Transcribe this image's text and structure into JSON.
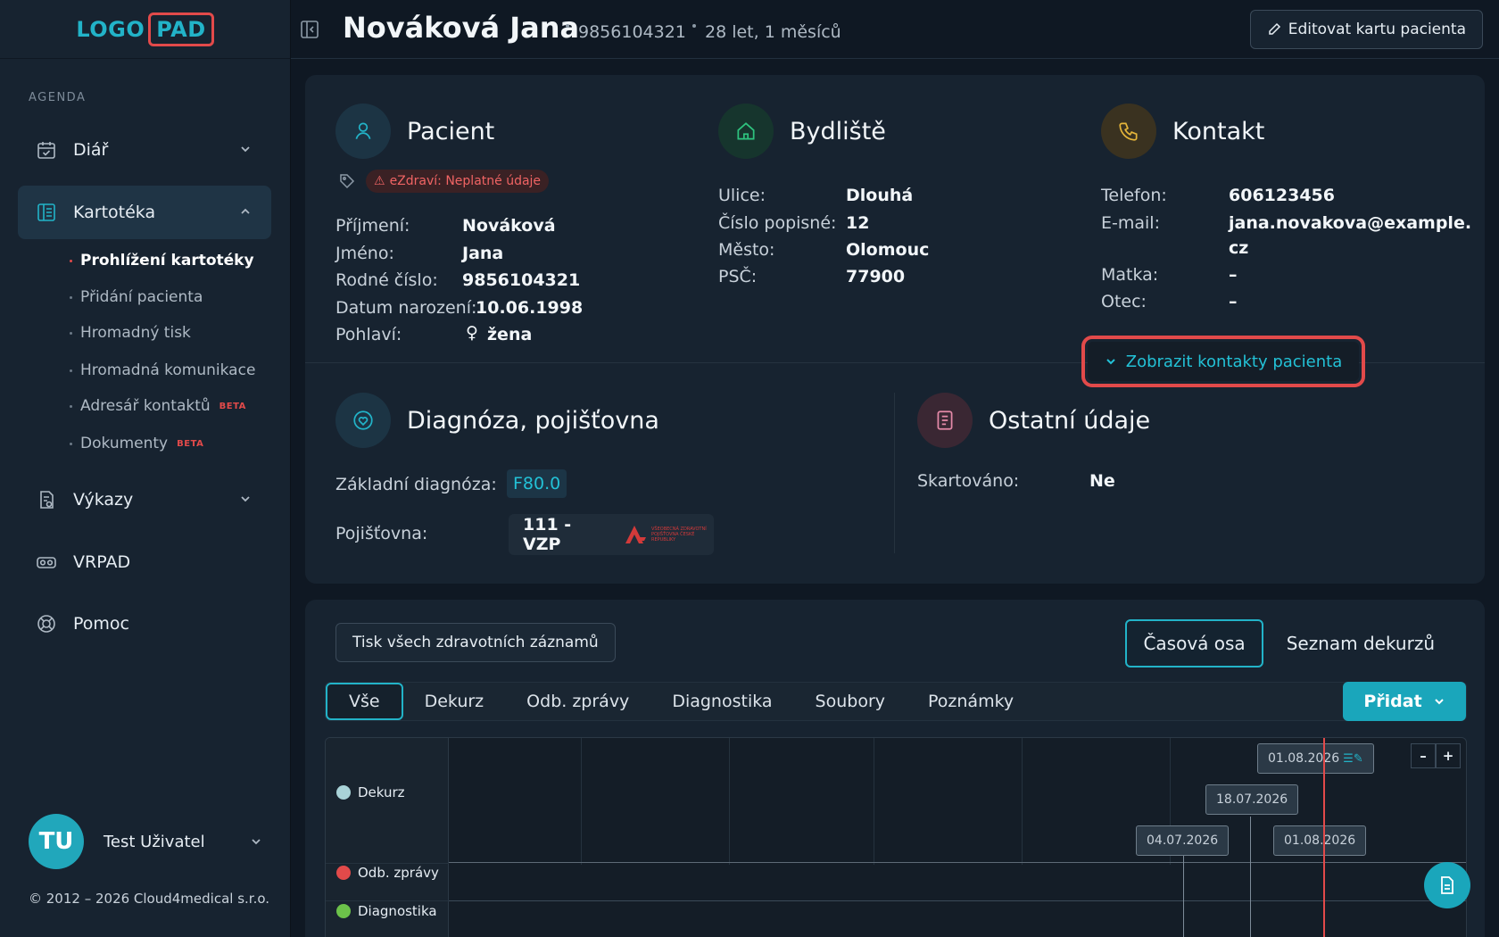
{
  "logo": {
    "part1": "LOGO",
    "part2": "PAD"
  },
  "sidebar": {
    "section_label": "AGENDA",
    "items": [
      {
        "label": "Diář",
        "icon": "calendar-icon"
      },
      {
        "label": "Kartotéka",
        "icon": "folder-icon"
      },
      {
        "label": "Výkazy",
        "icon": "report-icon"
      },
      {
        "label": "VRPAD",
        "icon": "vr-icon"
      },
      {
        "label": "Pomoc",
        "icon": "lifebuoy-icon"
      }
    ],
    "subitems": [
      {
        "label": "Prohlížení kartotéky"
      },
      {
        "label": "Přidání pacienta"
      },
      {
        "label": "Hromadný tisk"
      },
      {
        "label": "Hromadná komunikace"
      },
      {
        "label": "Adresář kontaktů",
        "badge": "BETA"
      },
      {
        "label": "Dokumenty",
        "badge": "BETA"
      }
    ],
    "user": {
      "initials": "TU",
      "name": "Test Uživatel"
    },
    "copyright": "© 2012 – 2026 Cloud4medical s.r.o."
  },
  "header": {
    "patient_name": "Nováková Jana",
    "birth_number": "9856104321",
    "age": "28 let, 1 měsíců",
    "edit_label": "Editovat kartu pacienta"
  },
  "patient": {
    "title": "Pacient",
    "ezdravi": "eZdraví: Neplatné údaje",
    "fields": [
      {
        "k": "Příjmení:",
        "v": "Nováková"
      },
      {
        "k": "Jméno:",
        "v": "Jana"
      },
      {
        "k": "Rodné číslo:",
        "v": "9856104321"
      },
      {
        "k": "Datum narození:",
        "v": "10.06.1998"
      },
      {
        "k": "Pohlaví:",
        "v": "žena"
      }
    ]
  },
  "residence": {
    "title": "Bydliště",
    "fields": [
      {
        "k": "Ulice:",
        "v": "Dlouhá"
      },
      {
        "k": "Číslo popisné:",
        "v": "12"
      },
      {
        "k": "Město:",
        "v": "Olomouc"
      },
      {
        "k": "PSČ:",
        "v": "77900"
      }
    ]
  },
  "contact": {
    "title": "Kontakt",
    "fields": [
      {
        "k": "Telefon:",
        "v": "606123456"
      },
      {
        "k": "E-mail:",
        "v": "jana.novakova@example.",
        "v2": "cz"
      },
      {
        "k": "Matka:",
        "v": "–"
      },
      {
        "k": "Otec:",
        "v": "–"
      }
    ],
    "show_contacts": "Zobrazit kontakty pacienta"
  },
  "diagnosis": {
    "title": "Diagnóza, pojišťovna",
    "base_label": "Základní diagnóza:",
    "base_value": "F80.0",
    "insurer_label": "Pojišťovna:",
    "insurer_value": "111 - VZP",
    "insurer_logo_text": "VŠEOBECNÁ ZDRAVOTNÍ POJIŠŤOVNA ČESKÉ REPUBLIKY"
  },
  "other": {
    "title": "Ostatní údaje",
    "shred_label": "Skartováno:",
    "shred_value": "Ne"
  },
  "records": {
    "print_all": "Tisk všech zdravotních záznamů",
    "view_timeline": "Časová osa",
    "view_list": "Seznam dekurzů",
    "tabs": [
      "Vše",
      "Dekurz",
      "Odb. zprávy",
      "Diagnostika",
      "Soubory",
      "Poznámky"
    ],
    "add_label": "Přidat",
    "timeline": {
      "rows": [
        {
          "label": "Dekurz",
          "color": "#a9d3d8"
        },
        {
          "label": "Odb. zprávy",
          "color": "#e24a4a"
        },
        {
          "label": "Diagnostika",
          "color": "#6cc24a"
        }
      ],
      "chips": [
        "01.08.2026",
        "18.07.2026",
        "04.07.2026",
        "01.08.2026"
      ],
      "zoom_out": "–",
      "zoom_in": "+"
    }
  },
  "colors": {
    "accent": "#22b3c8",
    "danger": "#e24a4a",
    "bg": "#0f1823",
    "panel": "#172330"
  }
}
